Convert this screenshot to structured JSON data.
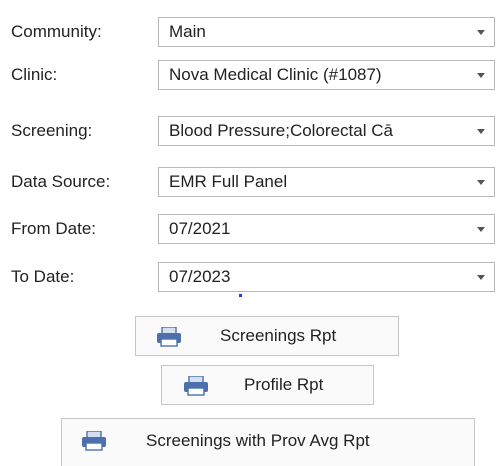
{
  "form": {
    "community": {
      "label": "Community:",
      "value": "Main"
    },
    "clinic": {
      "label": "Clinic:",
      "value": "Nova Medical Clinic (#1087)"
    },
    "screening": {
      "label": "Screening:",
      "value": "Blood Pressure;Colorectal Cā"
    },
    "data_source": {
      "label": "Data Source:",
      "value": "EMR Full Panel"
    },
    "from_date": {
      "label": "From Date:",
      "value": "07/2021"
    },
    "to_date": {
      "label": "To Date:",
      "value": "07/2023"
    }
  },
  "buttons": {
    "screenings_rpt": "Screenings Rpt",
    "profile_rpt": "Profile Rpt",
    "screenings_prov_avg_rpt": "Screenings with Prov Avg Rpt"
  },
  "icons": {
    "button_icon": "printer-icon"
  },
  "colors": {
    "printer_body": "#4d6fae",
    "printer_paper": "#d4dff0"
  }
}
